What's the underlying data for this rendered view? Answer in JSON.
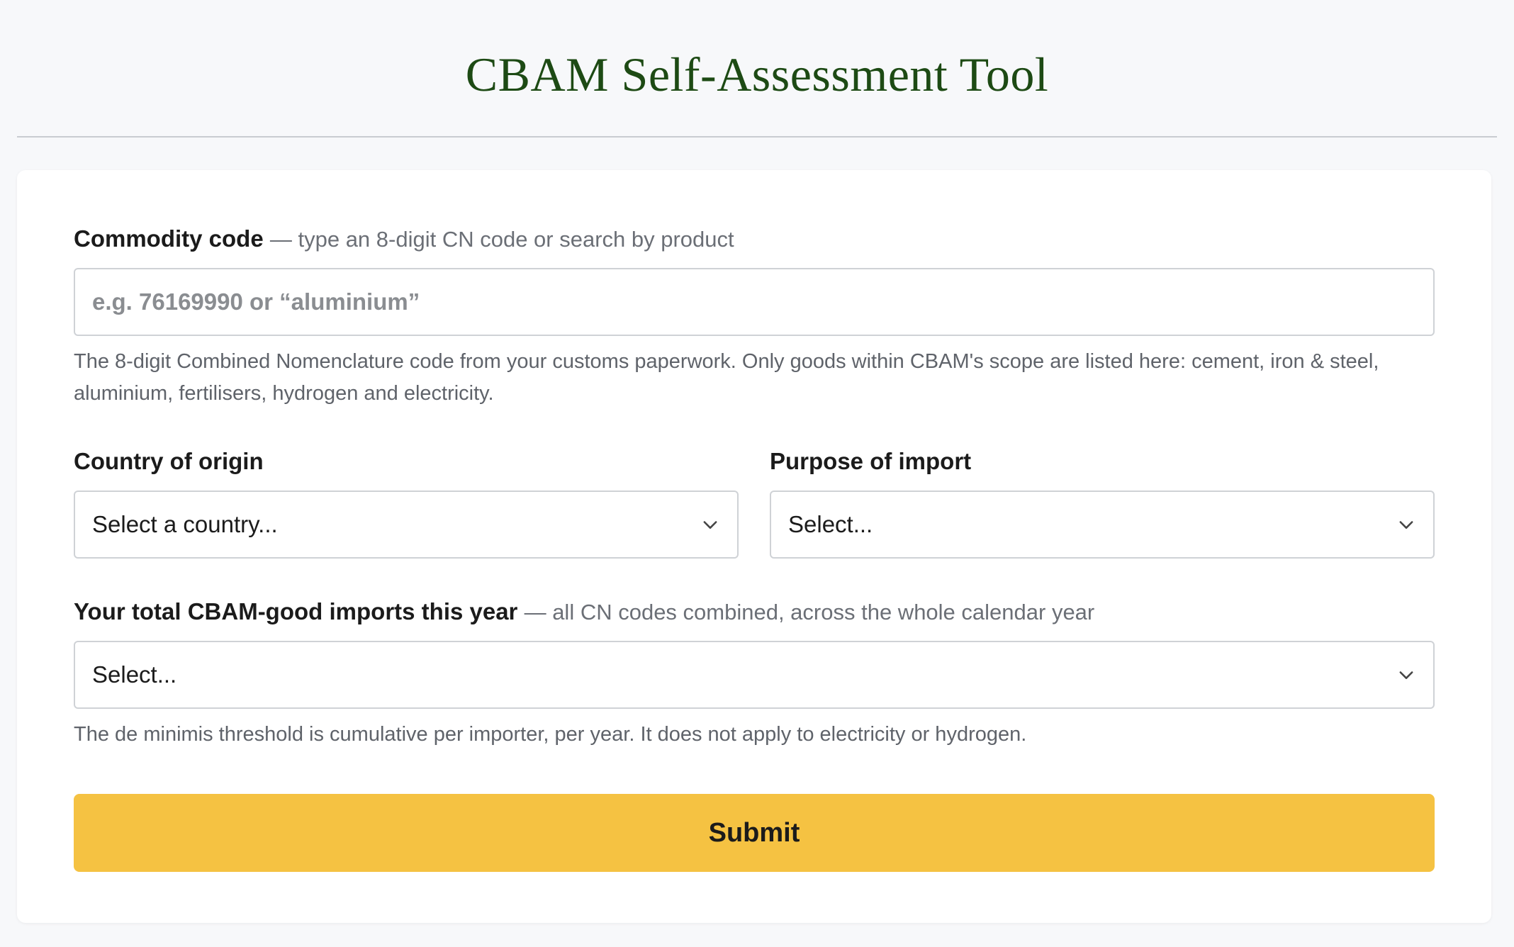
{
  "page": {
    "title": "CBAM Self-Assessment Tool"
  },
  "form": {
    "commodity": {
      "label": "Commodity code",
      "hint": "— type an 8-digit CN code or search by product",
      "value": "",
      "placeholder": "e.g. 76169990 or “aluminium”",
      "help": "The 8-digit Combined Nomenclature code from your customs paperwork. Only goods within CBAM's scope are listed here: cement, iron & steel, aluminium, fertilisers, hydrogen and electricity."
    },
    "country": {
      "label": "Country of origin",
      "selected": "Select a country..."
    },
    "purpose": {
      "label": "Purpose of import",
      "selected": "Select..."
    },
    "total_imports": {
      "label": "Your total CBAM-good imports this year",
      "hint": "— all CN codes combined, across the whole calendar year",
      "selected": "Select...",
      "help": "The de minimis threshold is cumulative per importer, per year. It does not apply to electricity or hydrogen."
    },
    "submit_label": "Submit"
  },
  "colors": {
    "title": "#1d4a14",
    "button": "#f5c242",
    "background": "#f7f8fa"
  },
  "icons": {
    "select_arrow": "chevron-down-icon"
  }
}
